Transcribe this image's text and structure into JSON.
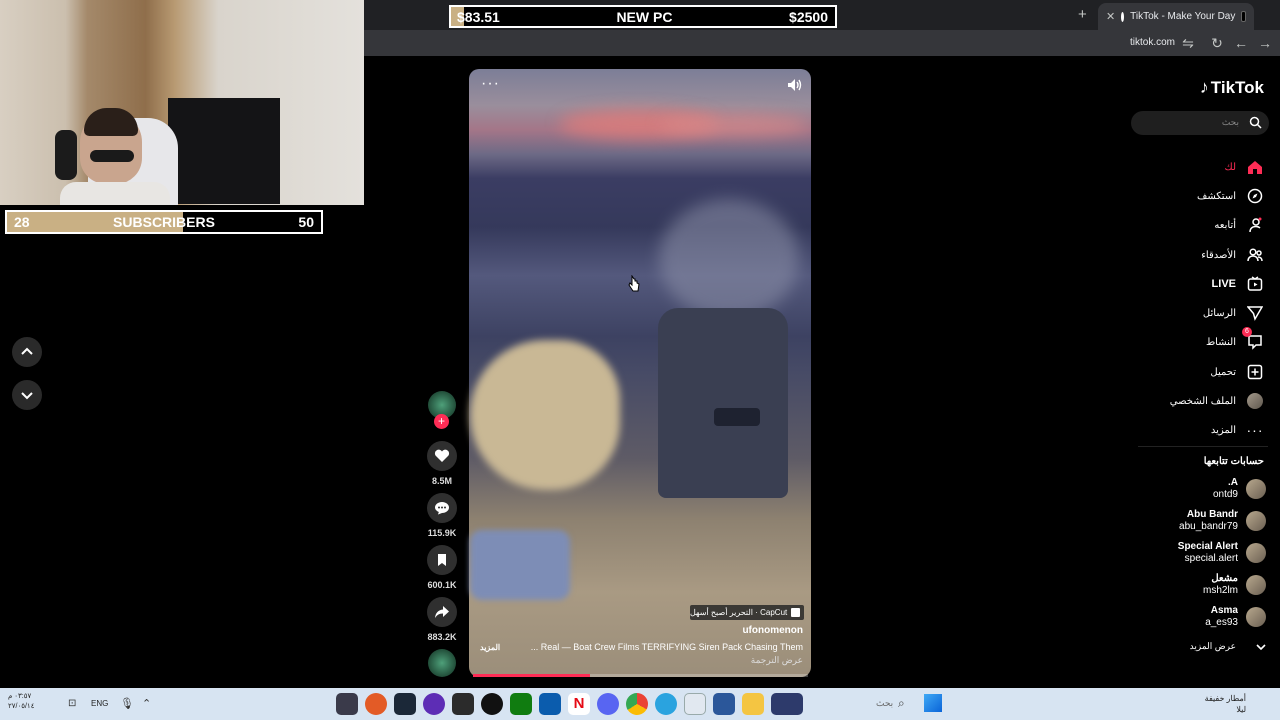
{
  "overlay": {
    "subscribers": {
      "current": "28",
      "label": "SUBSCRIBERS",
      "goal": "50",
      "progress": 0.56
    },
    "pc_goal": {
      "current": "$83.51",
      "label": "NEW PC",
      "goal": "$2500",
      "progress": 0.033
    }
  },
  "browser": {
    "tab_title": "TikTok - Make Your Day",
    "new_tab": "+",
    "url": "tiktok.com"
  },
  "tiktok": {
    "logo": "TikTok",
    "search_placeholder": "بحث",
    "nav": [
      {
        "label": "لك",
        "icon": "home-icon"
      },
      {
        "label": "استكشف",
        "icon": "compass-icon"
      },
      {
        "label": "أتابعه",
        "icon": "following-icon"
      },
      {
        "label": "الأصدقاء",
        "icon": "friends-icon"
      },
      {
        "label": "LIVE",
        "icon": "live-icon"
      },
      {
        "label": "الرسائل",
        "icon": "messages-icon"
      },
      {
        "label": "النشاط",
        "icon": "activity-icon",
        "badge": "6"
      },
      {
        "label": "تحميل",
        "icon": "upload-icon"
      },
      {
        "label": "الملف الشخصي",
        "icon": "profile-avatar"
      },
      {
        "label": "المزيد",
        "icon": "more-icon"
      }
    ],
    "following_header": "حسابات تتابعها",
    "following": [
      {
        "name": "A.",
        "handle": "ontd9"
      },
      {
        "name": "Abu Bandr",
        "handle": "abu_bandr79"
      },
      {
        "name": "Special Alert",
        "handle": "special.alert"
      },
      {
        "name": "مشعل",
        "handle": "msh2lm"
      },
      {
        "name": "Asma",
        "handle": "a_es93"
      }
    ],
    "see_more": "عرض المزيد",
    "video": {
      "capcut": "CapCut · التحرير أصبح أسهل",
      "author": "ufonomenon",
      "caption": "Real — Boat Crew Films TERRIFYING Siren Pack Chasing Them ...",
      "more": "المزيد",
      "translate": "عرض الترجمة",
      "progress": 0.35
    },
    "actions": {
      "likes": "8.5M",
      "comments": "115.9K",
      "saves": "600.1K",
      "shares": "883.2K"
    }
  },
  "taskbar": {
    "search": "بحث",
    "language": "ENG",
    "time": "٠٣:٥٧ م",
    "date": "٢٧/٠٥/١٤",
    "weather": "أمطار خفيفة",
    "weather_sub": "ليلا"
  }
}
